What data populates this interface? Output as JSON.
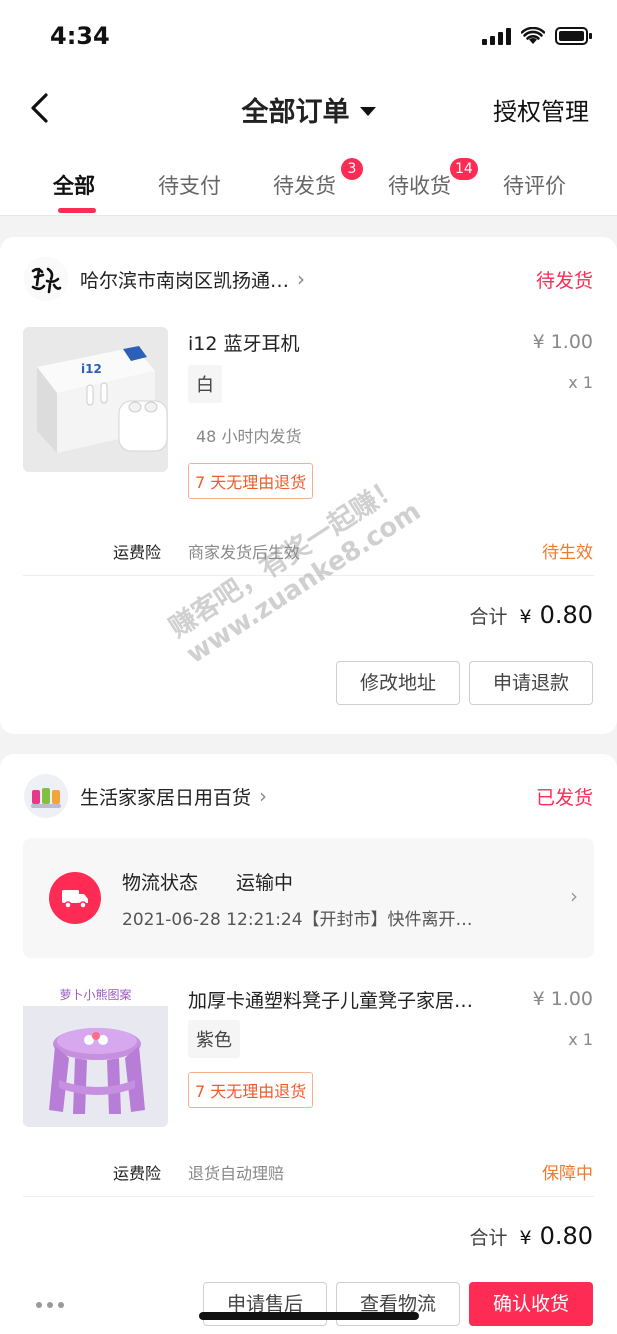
{
  "status_bar": {
    "time": "4:34"
  },
  "nav": {
    "title": "全部订单",
    "right_label": "授权管理"
  },
  "tabs": [
    {
      "label": "全部",
      "badge": ""
    },
    {
      "label": "待支付",
      "badge": ""
    },
    {
      "label": "待发货",
      "badge": "3"
    },
    {
      "label": "待收货",
      "badge": "14"
    },
    {
      "label": "待评价",
      "badge": ""
    }
  ],
  "orders": [
    {
      "shop_name": "哈尔滨市南岗区凯扬通…",
      "status": "待发货",
      "product": {
        "title": "i12 蓝牙耳机",
        "price": "¥ 1.00",
        "qty": "x 1",
        "spec": "白",
        "ship_note": "48 小时内发货",
        "tag": "7 天无理由退货"
      },
      "insurance": {
        "label": "运费险",
        "desc": "商家发货后生效",
        "status": "待生效"
      },
      "total": {
        "label": "合计",
        "currency": "¥",
        "amount": "0.80"
      },
      "buttons": [
        "修改地址",
        "申请退款"
      ]
    },
    {
      "shop_name": "生活家家居日用百货",
      "status": "已发货",
      "logistics": {
        "label": "物流状态",
        "state": "运输中",
        "detail": "2021-06-28 12:21:24【开封市】快件离开…"
      },
      "product": {
        "title": "加厚卡通塑料凳子儿童凳子家居…",
        "price": "¥ 1.00",
        "qty": "x 1",
        "spec": "紫色",
        "tag": "7 天无理由退货",
        "image_caption": "萝卜小熊图案"
      },
      "insurance": {
        "label": "运费险",
        "desc": "退货自动理赔",
        "status": "保障中"
      },
      "total": {
        "label": "合计",
        "currency": "¥",
        "amount": "0.80"
      },
      "buttons": [
        "申请售后",
        "查看物流",
        "确认收货"
      ]
    }
  ],
  "watermark": {
    "line1": "赚客吧，有奖一起赚！",
    "line2": "www.zuanke8.com"
  },
  "colors": {
    "accent": "#fe2c55",
    "orange": "#f07a2b",
    "tag_border": "#f7b08f"
  }
}
